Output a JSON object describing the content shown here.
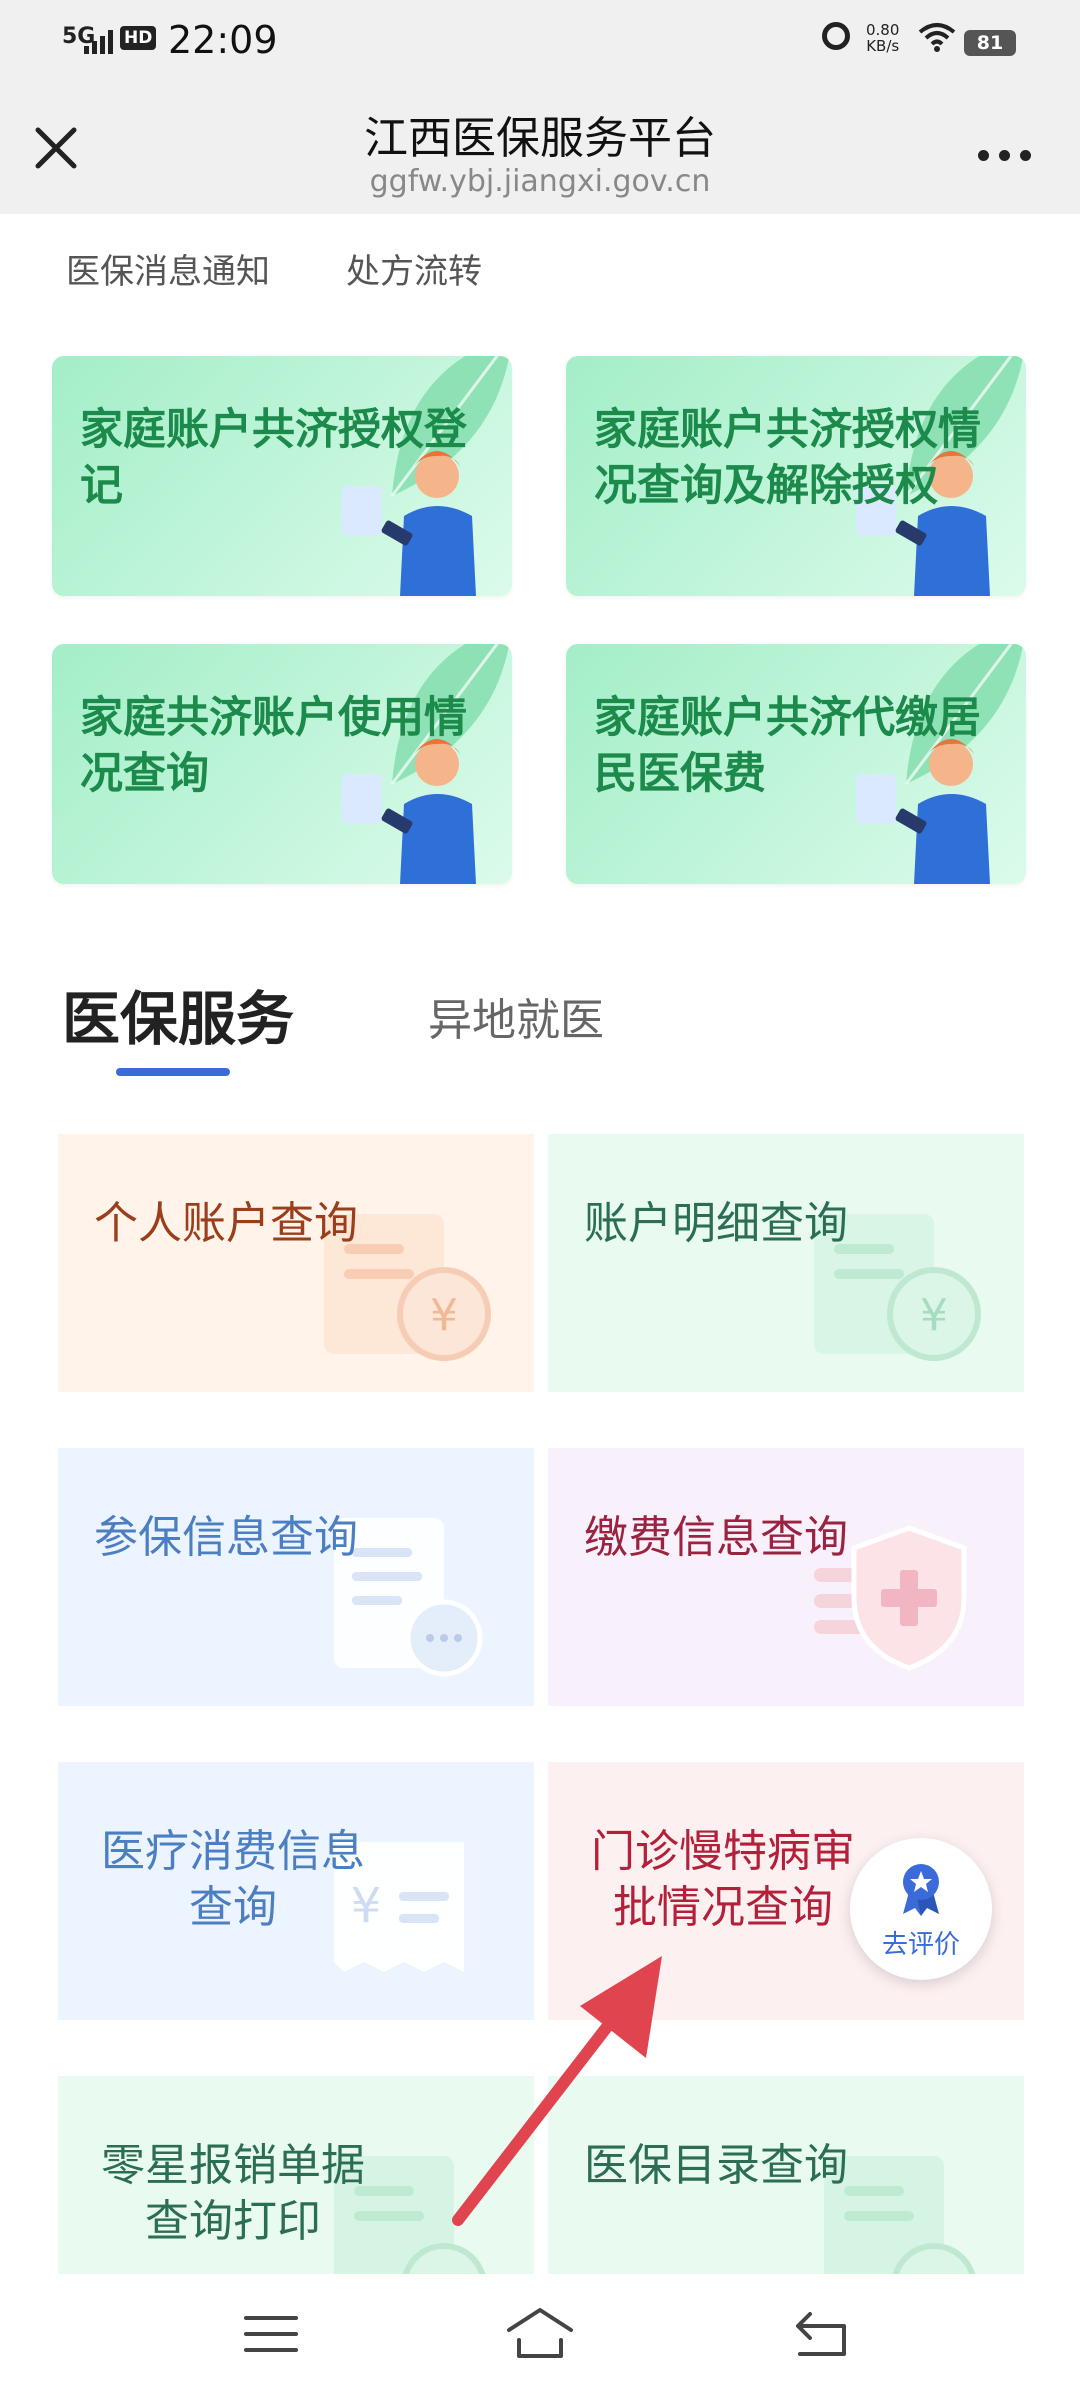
{
  "status_bar": {
    "signal": "5G",
    "hd": "HD",
    "time": "22:09",
    "net_speed": "0.80",
    "net_unit": "KB/s",
    "battery": "81"
  },
  "title_bar": {
    "title": "江西医保服务平台",
    "url": "ggfw.ybj.jiangxi.gov.cn"
  },
  "top_links": [
    "医保消息通知",
    "处方流转"
  ],
  "banners": [
    {
      "label": "家庭账户共济授权登记"
    },
    {
      "label": "家庭账户共济授权情况查询及解除授权"
    },
    {
      "label": "家庭共济账户使用情况查询"
    },
    {
      "label": "家庭账户共济代缴居民医保费"
    }
  ],
  "tabs": {
    "active": "医保服务",
    "inactive": "异地就医"
  },
  "services": [
    {
      "line1": "个人账户查询",
      "line2": ""
    },
    {
      "line1": "账户明细查询",
      "line2": ""
    },
    {
      "line1": "参保信息查询",
      "line2": ""
    },
    {
      "line1": "缴费信息查询",
      "line2": ""
    },
    {
      "line1": "医疗消费信息",
      "line2": "查询"
    },
    {
      "line1": "门诊慢特病审",
      "line2": "批情况查询"
    },
    {
      "line1": "零星报销单据",
      "line2": "查询打印"
    },
    {
      "line1": "医保目录查询",
      "line2": ""
    }
  ],
  "rate_button": {
    "label": "去评价"
  },
  "colors": {
    "accent_blue": "#3a6bd8",
    "banner_green": "#1b8a4a",
    "arrow_red": "#e0444f"
  },
  "icons": {
    "close": "close-icon",
    "more": "more-dots-icon",
    "nav_menu": "menu-icon",
    "nav_home": "home-icon",
    "nav_back": "back-icon"
  }
}
